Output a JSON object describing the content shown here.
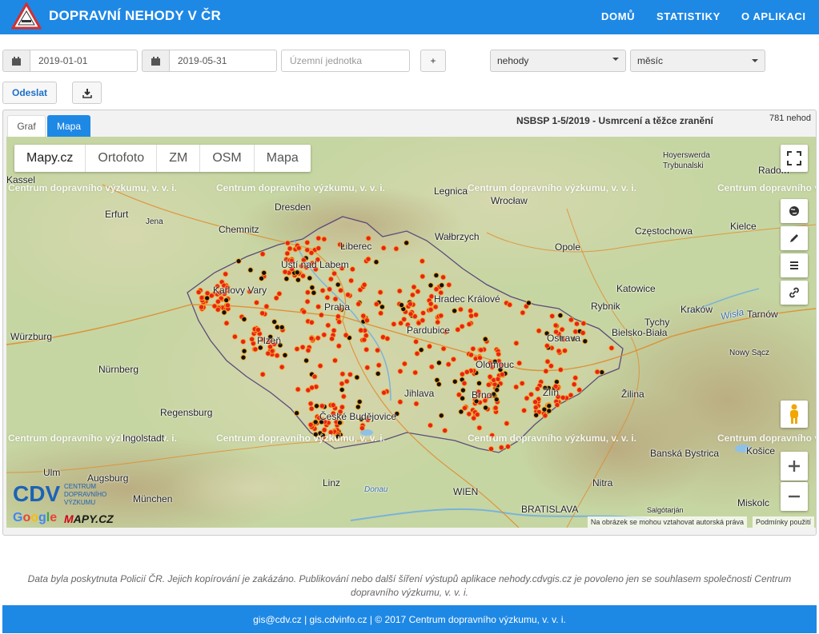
{
  "header": {
    "title": "DOPRAVNÍ NEHODY V ČR",
    "nav": [
      "DOMŮ",
      "STATISTIKY",
      "O APLIKACI"
    ],
    "bg_color": "#1e88e5"
  },
  "filters": {
    "date_from": "2019-01-01",
    "date_to": "2019-05-31",
    "territory_placeholder": "Územní jednotka",
    "add_label": "+",
    "type_select": "nehody",
    "period_select": "měsíc",
    "submit_label": "Odeslat",
    "download_icon": "download-icon"
  },
  "panel": {
    "tabs": [
      "Graf",
      "Mapa"
    ],
    "active_tab": "Mapa",
    "title": "NSBSP 1-5/2019 - Usmrcení a těžce zranění",
    "count": "781 nehod"
  },
  "map": {
    "layers": [
      "Mapy.cz",
      "Ortofoto",
      "ZM",
      "OSM",
      "Mapa"
    ],
    "active_layer": "Mapy.cz",
    "watermark": "Centrum dopravního výzkumu, v. v. i.",
    "attribution": [
      "Na obrázek se mohou vztahovat autorská práva",
      "Podmínky použití"
    ],
    "logos": {
      "google": "Google",
      "mapy": "MAPY.CZ",
      "cdv": [
        "CENTRUM",
        "DOPRAVNÍHO",
        "VÝZKUMU"
      ]
    },
    "cities": [
      [
        "Kassel",
        "Hoyerswerda",
        "Legnica",
        "Wrocław",
        "Radom"
      ],
      [
        "Erfurt",
        "Jena",
        "Dresden",
        "Chemnitz",
        "Liberec",
        "Wałbrzych",
        "Opole",
        "Częstochowa",
        "Kielce"
      ],
      [
        "Karlovy Vary",
        "Ústí nad Labem",
        "Praha",
        "Hradec Králové",
        "Pardubice",
        "Katowice",
        "Rybnik",
        "Kraków",
        "Tarnów"
      ],
      [
        "Würzburg",
        "Plzeň",
        "Olomouc",
        "Ostrava",
        "Bielsko-Biała",
        "Tychy",
        "Nowy Sącz"
      ],
      [
        "Nürnberg",
        "Regensburg",
        "Ingolstadt",
        "Jihlava",
        "Brno",
        "Zlín",
        "Žilina",
        "České Budějovice"
      ],
      [
        "Ulm",
        "Augsburg",
        "München",
        "Linz",
        "Donau",
        "WIEN",
        "BRATISLAVA",
        "Nitra",
        "Banská Bystrica",
        "Košice",
        "Miskolc",
        "Salgótarján",
        "Trybunalski",
        "Wisła"
      ]
    ],
    "status_colors": {
      "severe": "#e8211b",
      "fatal": "#111111",
      "ring": "#f5a623"
    }
  },
  "footer": {
    "note": "Data byla poskytnuta Policií ČR. Jejich kopírování je zakázáno. Publikování nebo další šíření výstupů aplikace nehody.cdvgis.cz je povoleno jen se souhlasem společnosti Centrum dopravního výzkumu, v. v. i.",
    "bar": "gis@cdv.cz | gis.cdvinfo.cz | © 2017 Centrum dopravního výzkumu, v. v. i."
  }
}
